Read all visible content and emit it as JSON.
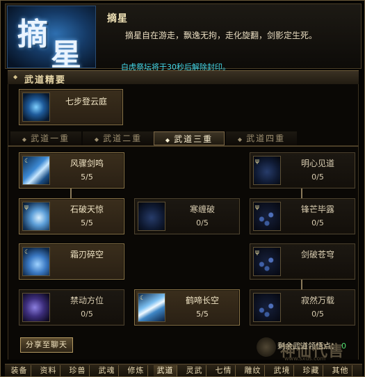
{
  "header": {
    "emblem_text_1": "摘",
    "emblem_text_2": "星",
    "title": "摘星",
    "description": "摘星自在游走，飘逸无拘，走化旋翻，剑影定生死。",
    "notice": "白虎祭坛将于30秒后解除封印。"
  },
  "section": {
    "title": "武道精要"
  },
  "core_skill": {
    "name": "七步登云庭",
    "icon": "lightning-figure-icon"
  },
  "tabs": [
    {
      "label": "武道一重",
      "active": false
    },
    {
      "label": "武道二重",
      "active": false
    },
    {
      "label": "武道三重",
      "active": true
    },
    {
      "label": "武道四重",
      "active": false
    }
  ],
  "skills": {
    "feng_zhou": {
      "name": "风骤剑鸣",
      "level": "5/5",
      "icon": "sword-gust-icon"
    },
    "ming_xin": {
      "name": "明心见道",
      "level": "0/5",
      "icon": "dark-figure-icon"
    },
    "shi_po": {
      "name": "石破天惊",
      "level": "5/5",
      "icon": "fist-strike-icon"
    },
    "han_chan": {
      "name": "寒缠破",
      "level": "0/5",
      "icon": "dark-swirl-icon"
    },
    "feng_mang": {
      "name": "锋芒毕露",
      "level": "0/5",
      "icon": "blue-dots-icon"
    },
    "shuang_ren": {
      "name": "霜刃碎空",
      "level": "5/5",
      "icon": "frost-hand-icon"
    },
    "jian_po": {
      "name": "剑破苍穹",
      "level": "0/5",
      "icon": "blue-dots-icon"
    },
    "jin_dong": {
      "name": "禁动方位",
      "level": "0/5",
      "icon": "purple-figure-icon"
    },
    "he_ti": {
      "name": "鹤啼长空",
      "level": "5/5",
      "icon": "wave-icon"
    },
    "ji_ran": {
      "name": "寂然万载",
      "level": "0/5",
      "icon": "blue-dots-icon"
    }
  },
  "share_button": "分享至聊天",
  "remaining": {
    "label": "剩余武道领悟点：",
    "value": "0"
  },
  "watermark": {
    "text": "神仙代售",
    "url": "www.sxds.com"
  },
  "bottom_tabs": [
    {
      "label": "装备",
      "active": false
    },
    {
      "label": "资料",
      "active": false
    },
    {
      "label": "珍兽",
      "active": false
    },
    {
      "label": "武魂",
      "active": false
    },
    {
      "label": "修炼",
      "active": false
    },
    {
      "label": "武道",
      "active": true
    },
    {
      "label": "灵武",
      "active": false
    },
    {
      "label": "七情",
      "active": false
    },
    {
      "label": "雕纹",
      "active": false
    },
    {
      "label": "武境",
      "active": false
    },
    {
      "label": "珍藏",
      "active": false
    },
    {
      "label": "其他",
      "active": false
    }
  ],
  "colors": {
    "gold_border": "#8a7448",
    "notice_cyan": "#44d8e8",
    "points_green": "#50e070"
  }
}
